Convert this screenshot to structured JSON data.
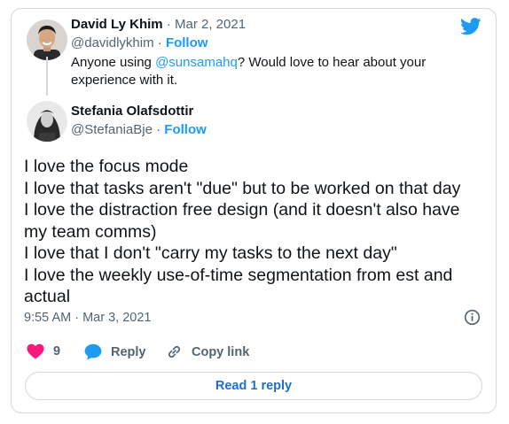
{
  "parent_tweet": {
    "name": "David Ly Khim",
    "date_sep": " · ",
    "date": "Mar 2, 2021",
    "handle": "@davidlykhim",
    "follow_sep": " · ",
    "follow": "Follow",
    "text_before": "Anyone using ",
    "mention": "@sunsamahq",
    "text_after": "? Would love to hear about your experience with it."
  },
  "main_tweet": {
    "name": "Stefania Olafsdottir",
    "handle": "@StefaniaBje",
    "follow_sep": " · ",
    "follow": "Follow",
    "lines": [
      "I love the focus mode",
      "I love that tasks aren't \"due\" but to be worked on that day",
      "I love the distraction free design (and it doesn't also have",
      "my team comms)",
      "I love that I don't \"carry my tasks to the next day\"",
      "I love the weekly use-of-time segmentation from est and",
      "actual"
    ],
    "timestamp": "9:55 AM · Mar 3, 2021"
  },
  "actions": {
    "like_count": "9",
    "reply_label": "Reply",
    "copy_label": "Copy link"
  },
  "read_replies": "Read 1 reply",
  "icons": {
    "brand": "twitter-bird-icon",
    "info": "info-icon",
    "like": "heart-icon",
    "reply": "speech-bubble-icon",
    "copy": "link-icon"
  },
  "colors": {
    "accent": "#1d9bf0",
    "like": "#f91880",
    "muted": "#536471",
    "border": "#cfd9de"
  }
}
